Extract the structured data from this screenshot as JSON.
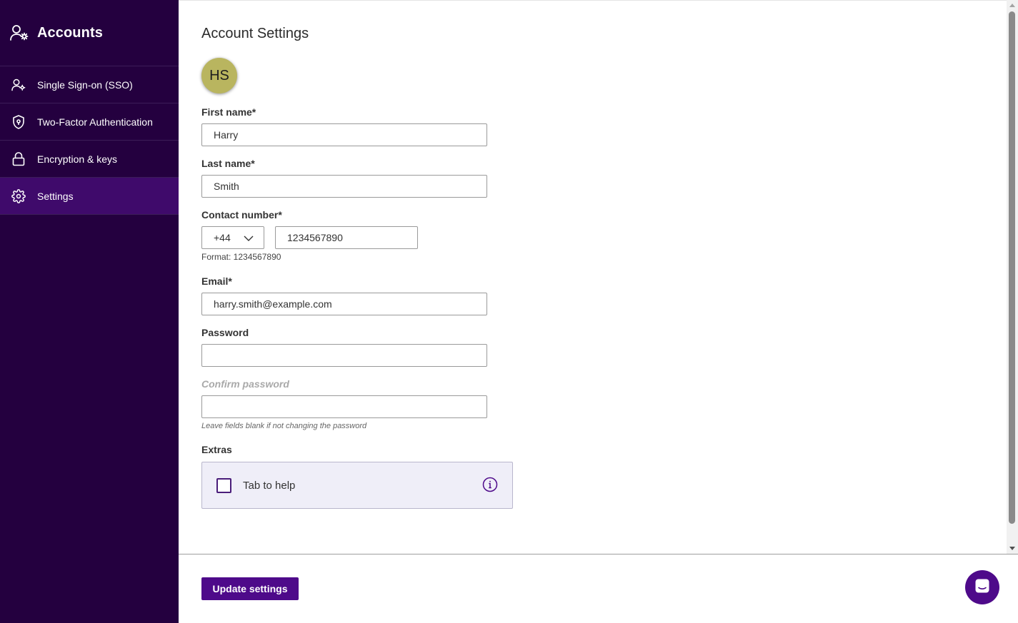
{
  "sidebar": {
    "title": "Accounts",
    "title_icon": "user-gear-icon",
    "items": [
      {
        "label": "Single Sign-on (SSO)",
        "icon": "user-gear-icon",
        "active": false
      },
      {
        "label": "Two-Factor Authentication",
        "icon": "shield-icon",
        "active": false
      },
      {
        "label": "Encryption & keys",
        "icon": "lock-icon",
        "active": false
      },
      {
        "label": "Settings",
        "icon": "gear-icon",
        "active": true
      }
    ]
  },
  "main": {
    "title": "Account Settings",
    "avatar_initials": "HS",
    "fields": {
      "first_name": {
        "label": "First name*",
        "value": "Harry"
      },
      "last_name": {
        "label": "Last name*",
        "value": "Smith"
      },
      "contact": {
        "label": "Contact number*",
        "country_code": "+44",
        "value": "1234567890",
        "helper": "Format: 1234567890"
      },
      "email": {
        "label": "Email*",
        "value": "harry.smith@example.com"
      },
      "password": {
        "label": "Password",
        "value": ""
      },
      "confirm_password": {
        "label": "Confirm password",
        "value": "",
        "helper": "Leave fields blank if not changing the password"
      }
    },
    "extras": {
      "label": "Extras",
      "checkbox_label": "Tab to help",
      "checked": false,
      "info_icon": "info-icon"
    }
  },
  "footer": {
    "update_label": "Update settings",
    "chat_icon": "chat-icon"
  },
  "colors": {
    "sidebar_bg": "#24003f",
    "sidebar_active": "#3f0a6b",
    "accent": "#4e0a8a",
    "avatar_bg": "#b9b55f",
    "extras_bg": "#efeef8"
  }
}
